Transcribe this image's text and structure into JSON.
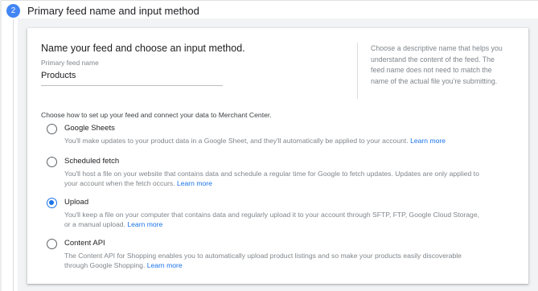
{
  "step": {
    "number": "2",
    "title": "Primary feed name and input method"
  },
  "card": {
    "heading": "Name your feed and choose an input method.",
    "field_label": "Primary feed name",
    "field_value": "Products",
    "help_text": "Choose a descriptive name that helps you understand the content of the feed. The feed name does not need to match the name of the actual file you're submitting."
  },
  "methods": {
    "prompt": "Choose how to set up your feed and connect your data to Merchant Center.",
    "selected": "Upload",
    "options": [
      {
        "label": "Google Sheets",
        "description": "You'll make updates to your product data in a Google Sheet, and they'll automatically be applied to your account.",
        "link": "Learn more"
      },
      {
        "label": "Scheduled fetch",
        "description": "You'll host a file on your website that contains data and schedule a regular time for Google to fetch updates. Updates are only applied to your account when the fetch occurs.",
        "link": "Learn more"
      },
      {
        "label": "Upload",
        "description": "You'll keep a file on your computer that contains data and regularly upload it to your account through SFTP, FTP, Google Cloud Storage, or a manual upload.",
        "link": "Learn more"
      },
      {
        "label": "Content API",
        "description": "The Content API for Shopping enables you to automatically upload product listings and so make your products easily discoverable through Google Shopping.",
        "link": "Learn more"
      }
    ]
  },
  "colors": {
    "accent": "#1a73e8",
    "step_badge": "#4285f4",
    "panel": "#f1f3f4"
  }
}
